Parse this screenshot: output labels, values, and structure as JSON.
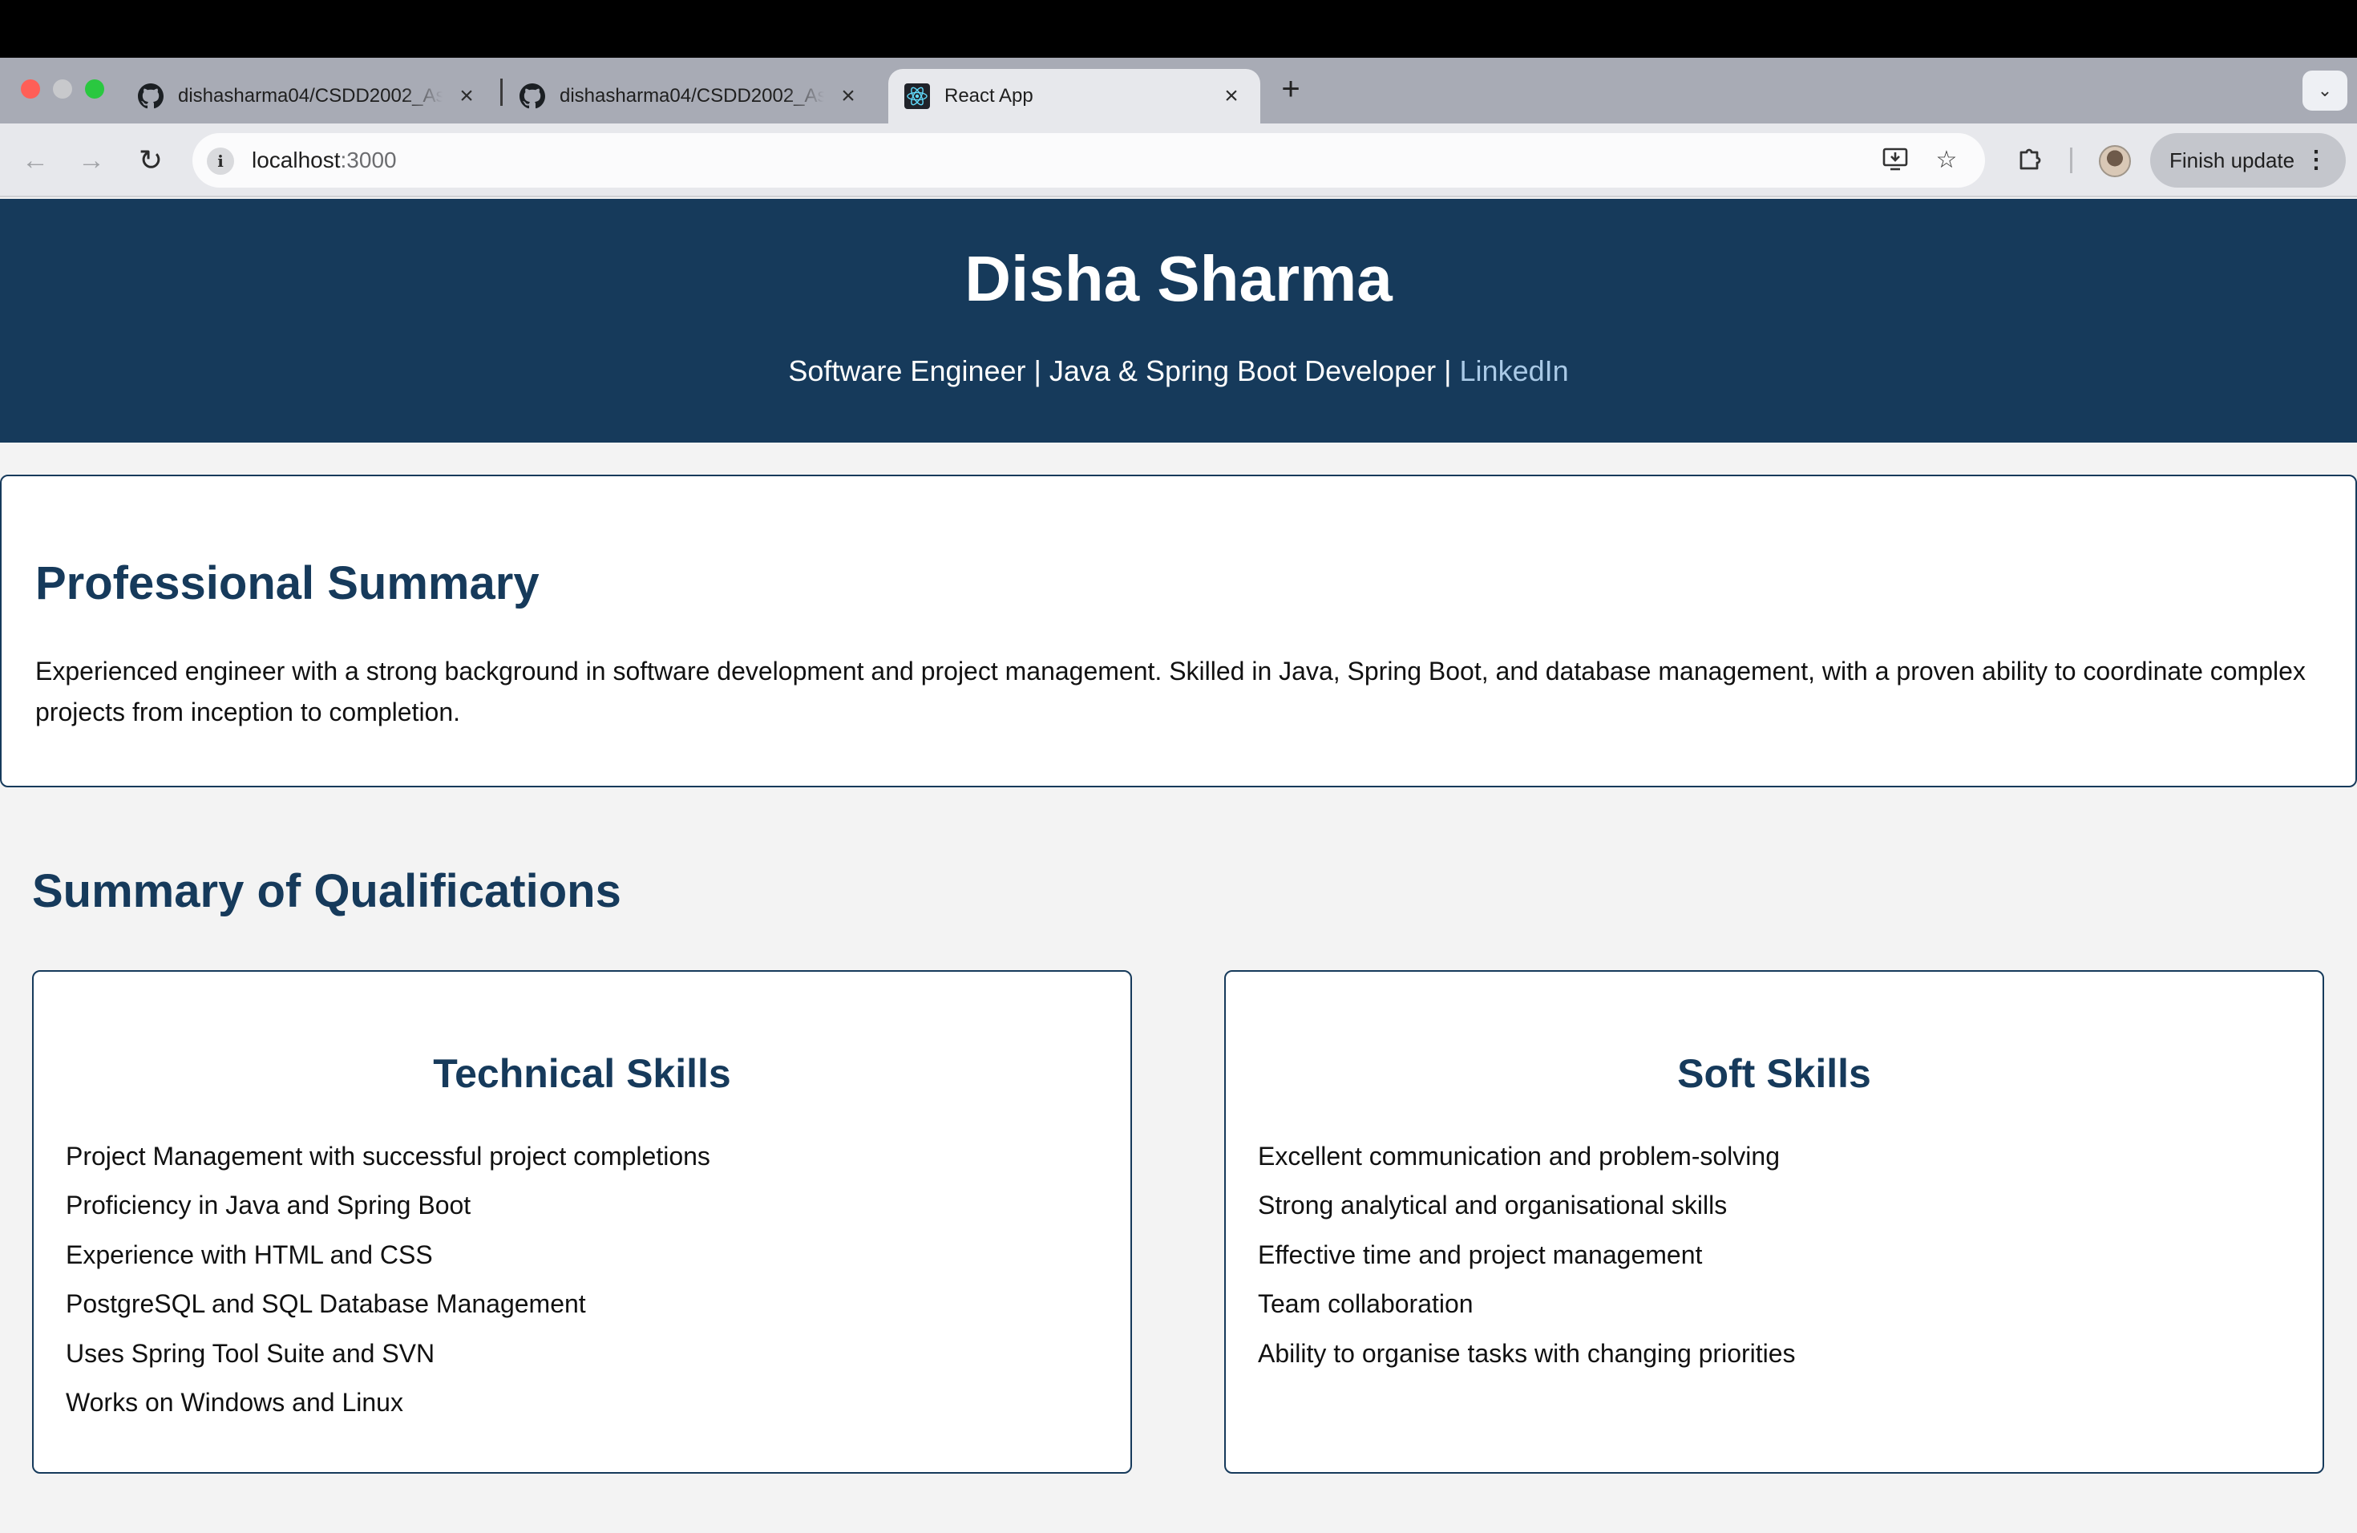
{
  "browser": {
    "tabs": [
      {
        "title": "dishasharma04/CSDD2002_Assignment",
        "favicon": "github-icon",
        "active": false
      },
      {
        "title": "dishasharma04/CSDD2002_Assignment",
        "favicon": "github-icon",
        "active": false
      },
      {
        "title": "React App",
        "favicon": "react-icon",
        "active": true
      }
    ],
    "address": {
      "host": "localhost",
      "port": ":3000"
    },
    "finish_update_label": "Finish update"
  },
  "header": {
    "name": "Disha Sharma",
    "tagline": "Software Engineer | Java & Spring Boot Developer | ",
    "link_label": "LinkedIn"
  },
  "summary": {
    "heading": "Professional Summary",
    "text": "Experienced engineer with a strong background in software development and project management. Skilled in Java, Spring Boot, and database management, with a proven ability to coordinate complex projects from inception to completion."
  },
  "qualifications": {
    "heading": "Summary of Qualifications",
    "technical": {
      "heading": "Technical Skills",
      "items": [
        "Project Management with successful project completions",
        "Proficiency in Java and Spring Boot",
        "Experience with HTML and CSS",
        "PostgreSQL and SQL Database Management",
        "Uses Spring Tool Suite and SVN",
        "Works on Windows and Linux"
      ]
    },
    "soft": {
      "heading": "Soft Skills",
      "items": [
        "Excellent communication and problem-solving",
        "Strong analytical and organisational skills",
        "Effective time and project management",
        "Team collaboration",
        "Ability to organise tasks with changing priorities"
      ]
    }
  },
  "colors": {
    "primary": "#163a5b",
    "page_background": "#f3f3f3",
    "link": "#a9c9e6"
  }
}
